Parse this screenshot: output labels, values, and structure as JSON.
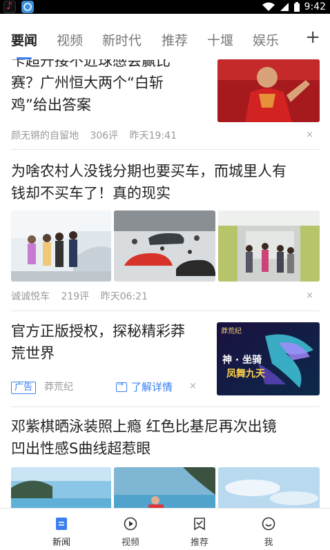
{
  "status_bar": {
    "apps": [
      "tiktok-icon",
      "browser-icon"
    ],
    "time": "9:42"
  },
  "tabs": [
    {
      "label": "要闻",
      "active": true
    },
    {
      "label": "视频"
    },
    {
      "label": "新时代"
    },
    {
      "label": "推荐"
    },
    {
      "label": "十堰"
    },
    {
      "label": "娱乐"
    }
  ],
  "add_tab": "+",
  "feed": [
    {
      "title": "卡超开接不近球感会赢比赛？广州恒大两个“白斩鸡”给出答案",
      "title_partial_top": "卡超开接不近球感会赢比",
      "title_line2": "赛？广州恒大两个“白斩",
      "title_line3": "鸡”给出答案",
      "source": "颜无锵的自留地",
      "comments": "306评",
      "time": "昨天19:41"
    },
    {
      "title_line1": "为啥农村人没钱分期也要买车，而城里人有",
      "title_line2": "钱却不买车了！真的现实",
      "source": "诚诚悦车",
      "comments": "219评",
      "time": "昨天06:21"
    },
    {
      "title_line1": "官方正版授权，探秘精彩莽",
      "title_line2": "荒世界",
      "ad_badge": "广告",
      "source": "莽荒纪",
      "cta": "了解详情",
      "banner_brand": "莽荒纪",
      "banner_text1": "神 · 坐骑",
      "banner_text2": "凤舞九天"
    },
    {
      "title_line1": "邓紫棋晒泳装照上瘾 红色比基尼再次出镜",
      "title_line2": "凹出性感S曲线超惹眼"
    }
  ],
  "close_symbol": "×",
  "bottom_nav": [
    {
      "label": "新闻",
      "icon": "news-icon",
      "active": true
    },
    {
      "label": "视频",
      "icon": "play-icon"
    },
    {
      "label": "推荐",
      "icon": "recommend-icon"
    },
    {
      "label": "我",
      "icon": "profile-icon"
    }
  ],
  "colors": {
    "accent": "#3a7ff0",
    "meta": "#9a9a9a"
  }
}
